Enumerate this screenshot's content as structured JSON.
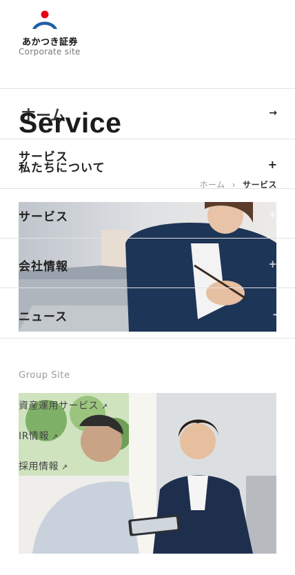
{
  "brand": {
    "name": "あかつき証券",
    "tagline": "Corporate site",
    "colors": {
      "red": "#e60012",
      "blue": "#1f5fa8"
    }
  },
  "nav_ghost": {
    "home": "ホーム"
  },
  "page_title": "Service",
  "nav": {
    "service_arrow_icon": "arrow-right-icon",
    "items": [
      {
        "label": "サービス"
      },
      {
        "label": "私たちについて"
      }
    ]
  },
  "breadcrumb": {
    "home": "ホーム",
    "sep": "›",
    "current": "サービス"
  },
  "hero_menu": [
    {
      "label": "サービス"
    },
    {
      "label": "会社情報"
    },
    {
      "label": "ニュース"
    }
  ],
  "group": {
    "label": "Group Site",
    "links": [
      {
        "label": "資産運用サービス",
        "ext": "↗"
      },
      {
        "label": "IR情報",
        "ext": "↗"
      },
      {
        "label": "採用情報",
        "ext": "↗"
      }
    ]
  }
}
